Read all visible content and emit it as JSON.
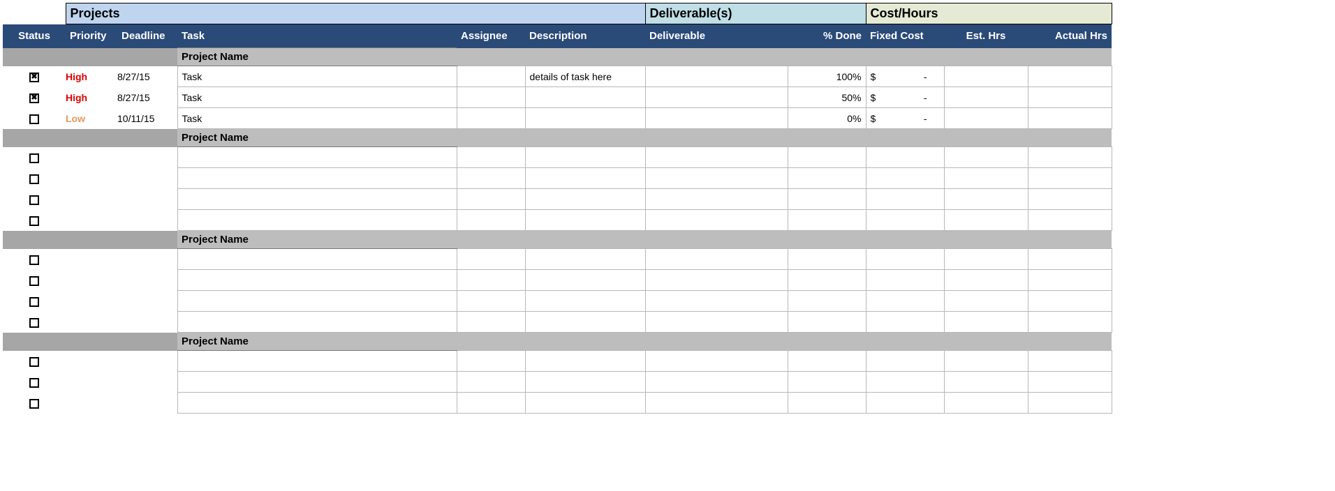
{
  "sections": {
    "projects": "Projects",
    "deliverables": "Deliverable(s)",
    "costhours": "Cost/Hours"
  },
  "columns": {
    "status": "Status",
    "priority": "Priority",
    "deadline": "Deadline",
    "task": "Task",
    "assignee": "Assignee",
    "description": "Description",
    "deliverable": "Deliverable",
    "pct_done": "% Done",
    "fixed_cost": "Fixed Cost",
    "est_hrs": "Est. Hrs",
    "actual_hrs": "Actual Hrs"
  },
  "currency_symbol": "$",
  "dash": "-",
  "groups": [
    {
      "name": "Project Name",
      "rows": [
        {
          "checked": true,
          "priority": "High",
          "deadline": "8/27/15",
          "task": "Task",
          "assignee": "",
          "description": "details of task here",
          "deliverable": "",
          "pct_done": "100%",
          "fixed_cost": "-",
          "est_hrs": "",
          "actual_hrs": ""
        },
        {
          "checked": true,
          "priority": "High",
          "deadline": "8/27/15",
          "task": "Task",
          "assignee": "",
          "description": "",
          "deliverable": "",
          "pct_done": "50%",
          "fixed_cost": "-",
          "est_hrs": "",
          "actual_hrs": ""
        },
        {
          "checked": false,
          "priority": "Low",
          "deadline": "10/11/15",
          "task": "Task",
          "assignee": "",
          "description": "",
          "deliverable": "",
          "pct_done": "0%",
          "fixed_cost": "-",
          "est_hrs": "",
          "actual_hrs": ""
        }
      ]
    },
    {
      "name": "Project Name",
      "rows": [
        {
          "checked": false,
          "priority": "",
          "deadline": "",
          "task": "",
          "assignee": "",
          "description": "",
          "deliverable": "",
          "pct_done": "",
          "fixed_cost": "",
          "est_hrs": "",
          "actual_hrs": ""
        },
        {
          "checked": false,
          "priority": "",
          "deadline": "",
          "task": "",
          "assignee": "",
          "description": "",
          "deliverable": "",
          "pct_done": "",
          "fixed_cost": "",
          "est_hrs": "",
          "actual_hrs": ""
        },
        {
          "checked": false,
          "priority": "",
          "deadline": "",
          "task": "",
          "assignee": "",
          "description": "",
          "deliverable": "",
          "pct_done": "",
          "fixed_cost": "",
          "est_hrs": "",
          "actual_hrs": ""
        },
        {
          "checked": false,
          "priority": "",
          "deadline": "",
          "task": "",
          "assignee": "",
          "description": "",
          "deliverable": "",
          "pct_done": "",
          "fixed_cost": "",
          "est_hrs": "",
          "actual_hrs": ""
        }
      ]
    },
    {
      "name": "Project Name",
      "rows": [
        {
          "checked": false,
          "priority": "",
          "deadline": "",
          "task": "",
          "assignee": "",
          "description": "",
          "deliverable": "",
          "pct_done": "",
          "fixed_cost": "",
          "est_hrs": "",
          "actual_hrs": ""
        },
        {
          "checked": false,
          "priority": "",
          "deadline": "",
          "task": "",
          "assignee": "",
          "description": "",
          "deliverable": "",
          "pct_done": "",
          "fixed_cost": "",
          "est_hrs": "",
          "actual_hrs": ""
        },
        {
          "checked": false,
          "priority": "",
          "deadline": "",
          "task": "",
          "assignee": "",
          "description": "",
          "deliverable": "",
          "pct_done": "",
          "fixed_cost": "",
          "est_hrs": "",
          "actual_hrs": ""
        },
        {
          "checked": false,
          "priority": "",
          "deadline": "",
          "task": "",
          "assignee": "",
          "description": "",
          "deliverable": "",
          "pct_done": "",
          "fixed_cost": "",
          "est_hrs": "",
          "actual_hrs": ""
        }
      ]
    },
    {
      "name": "Project Name",
      "rows": [
        {
          "checked": false,
          "priority": "",
          "deadline": "",
          "task": "",
          "assignee": "",
          "description": "",
          "deliverable": "",
          "pct_done": "",
          "fixed_cost": "",
          "est_hrs": "",
          "actual_hrs": ""
        },
        {
          "checked": false,
          "priority": "",
          "deadline": "",
          "task": "",
          "assignee": "",
          "description": "",
          "deliverable": "",
          "pct_done": "",
          "fixed_cost": "",
          "est_hrs": "",
          "actual_hrs": ""
        },
        {
          "checked": false,
          "priority": "",
          "deadline": "",
          "task": "",
          "assignee": "",
          "description": "",
          "deliverable": "",
          "pct_done": "",
          "fixed_cost": "",
          "est_hrs": "",
          "actual_hrs": ""
        }
      ]
    }
  ]
}
